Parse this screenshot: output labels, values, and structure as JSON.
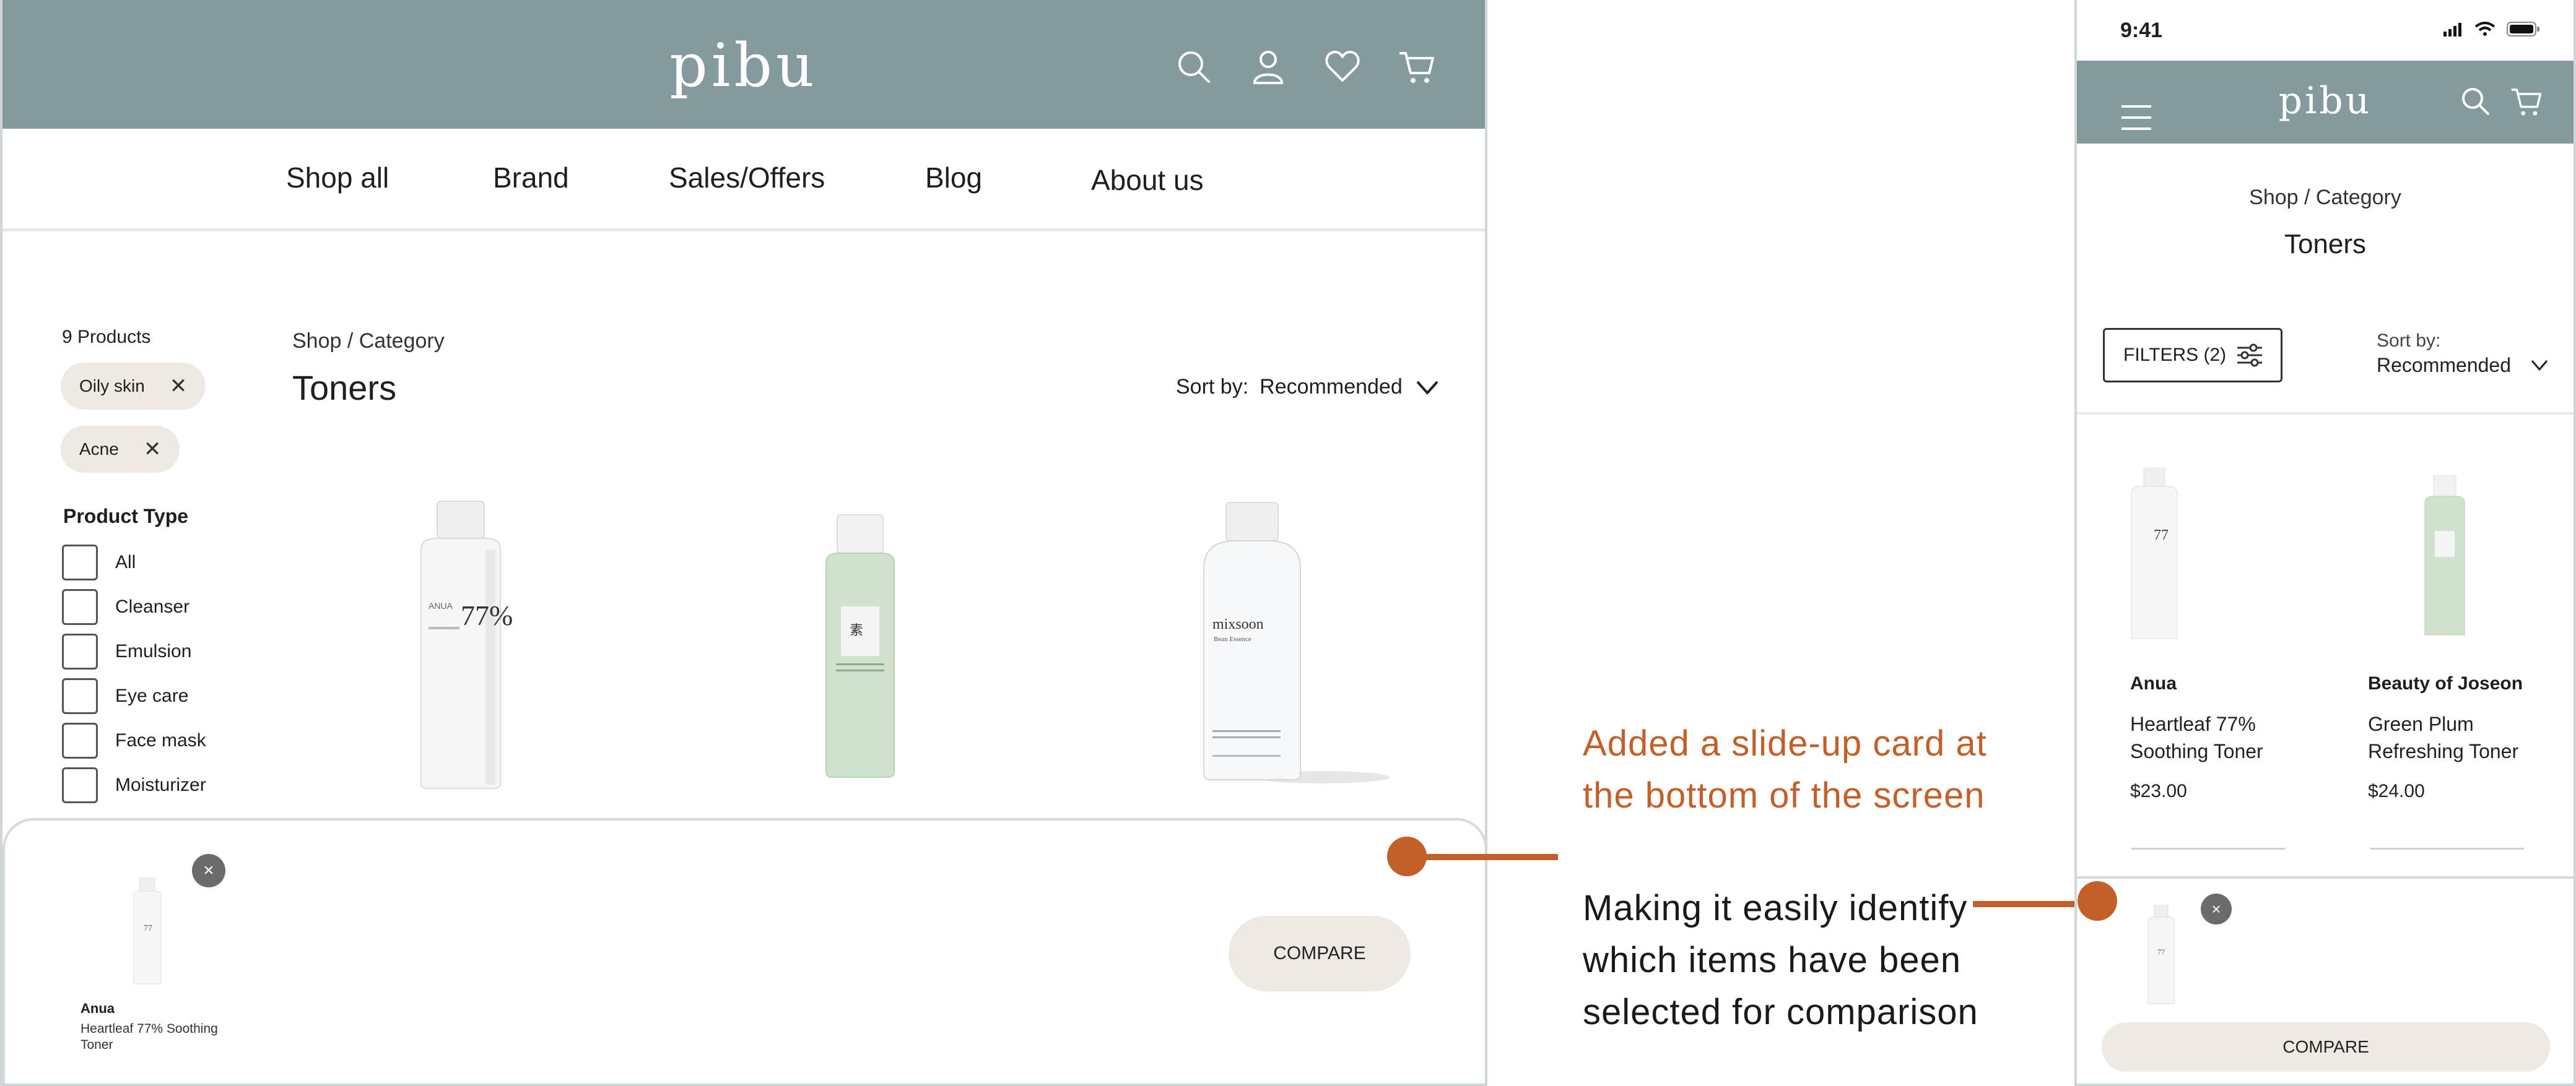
{
  "desktop": {
    "logo": "pibu",
    "nav": [
      "Shop all",
      "Brand",
      "Sales/Offers",
      "Blog",
      "About us"
    ],
    "product_count": "9 Products",
    "filters": [
      "Oily skin",
      "Acne"
    ],
    "product_type_label": "Product Type",
    "product_types": [
      "All",
      "Cleanser",
      "Emulsion",
      "Eye care",
      "Face mask",
      "Moisturizer"
    ],
    "breadcrumb": "Shop / Category",
    "title": "Toners",
    "sort_label": "Sort by:",
    "sort_value": "Recommended",
    "bottle_labels": [
      "ANUA",
      "77%",
      "mixsoon",
      "Bean Essence"
    ],
    "slide_card": {
      "close": "×",
      "brand": "Anua",
      "name": "Heartleaf 77% Soothing Toner",
      "compare": "COMPARE"
    }
  },
  "annotation": {
    "highlight": "Added a slide-up card at the bottom of the screen",
    "body": "Making it easily identify which items have been selected for comparison"
  },
  "mobile": {
    "time": "9:41",
    "logo": "pibu",
    "breadcrumb": "Shop / Category",
    "title": "Toners",
    "filters_button": "FILTERS (2)",
    "sort_label": "Sort by:",
    "sort_value": "Recommended",
    "products": [
      {
        "brand": "Anua",
        "name": "Heartleaf 77% Soothing Toner",
        "price": "$23.00"
      },
      {
        "brand": "Beauty of Joseon",
        "name": "Green Plum Refreshing Toner",
        "price": "$24.00"
      }
    ],
    "compare_button": "COMPARE",
    "close": "×"
  },
  "colors": {
    "header": "#859a9c",
    "accent": "#c35f28",
    "chip": "#efe9e3"
  }
}
